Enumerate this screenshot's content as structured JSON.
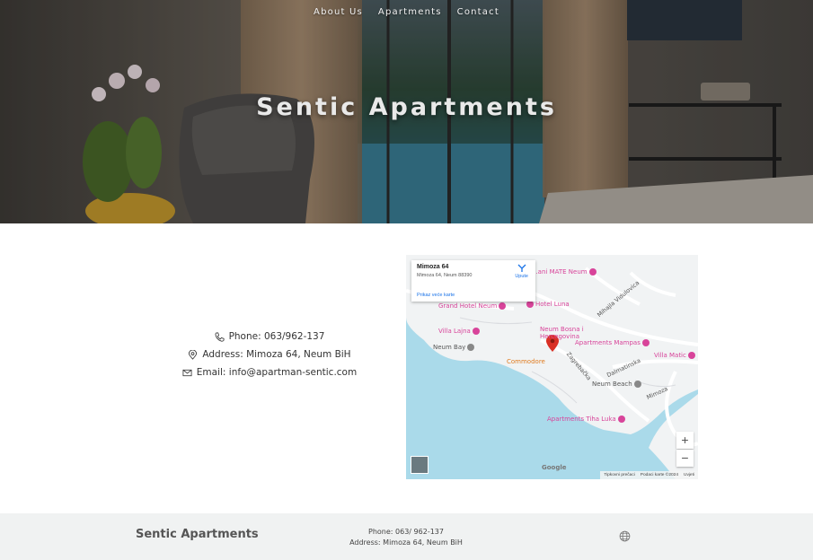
{
  "nav": {
    "items": [
      {
        "label": "About Us"
      },
      {
        "label": "Apartments"
      },
      {
        "label": "Contact"
      }
    ]
  },
  "hero": {
    "title": "Sentic Apartments"
  },
  "contact": {
    "phone": "Phone: 063/962-137",
    "address": "Address: Mimoza 64, Neum BiH",
    "email": "Email: info@apartman-sentic.com",
    "icons": [
      "phone-icon",
      "map-pin-icon",
      "envelope-icon"
    ]
  },
  "map": {
    "infobox": {
      "title": "Mimoza 64",
      "address": "Mimoza 64, Neum 88390",
      "directions_label": "Upute",
      "larger_map_label": "Prikaz veće karte"
    },
    "places": [
      {
        "name": "...ani MATE Neum",
        "kind": "hotel"
      },
      {
        "name": "Grand Hotel Neum",
        "kind": "hotel"
      },
      {
        "name": "Hotel Luna",
        "kind": "hotel"
      },
      {
        "name": "Villa Lajna",
        "kind": "hotel"
      },
      {
        "name": "Neum Bosna i Hercegovina",
        "kind": "hotel"
      },
      {
        "name": "Neum Bay",
        "kind": "landmark"
      },
      {
        "name": "Apartments Mampas",
        "kind": "hotel"
      },
      {
        "name": "Villa Matic",
        "kind": "hotel"
      },
      {
        "name": "Commodore",
        "kind": "restaurant"
      },
      {
        "name": "Neum Beach",
        "kind": "landmark"
      },
      {
        "name": "Apartments Tiha Luka",
        "kind": "hotel"
      }
    ],
    "roads": [
      "Mihajla Vidulovica",
      "Zagrebačka",
      "Dalmatinska",
      "Mimoza"
    ],
    "zoom_in": "+",
    "zoom_out": "−",
    "google_label": "Google",
    "footer": [
      "Tipkovni prečaci",
      "Podaci karte ©2024",
      "Uvjeti"
    ],
    "colors": {
      "water": "#aadaea",
      "land": "#f1f3f4",
      "marker": "#d93025"
    }
  },
  "footer": {
    "brand": "Sentic Apartments",
    "phone": "Phone: 063/ 962-137",
    "address": "Address: Mimoza 64, Neum BiH",
    "globe_icon": "globe-icon"
  }
}
